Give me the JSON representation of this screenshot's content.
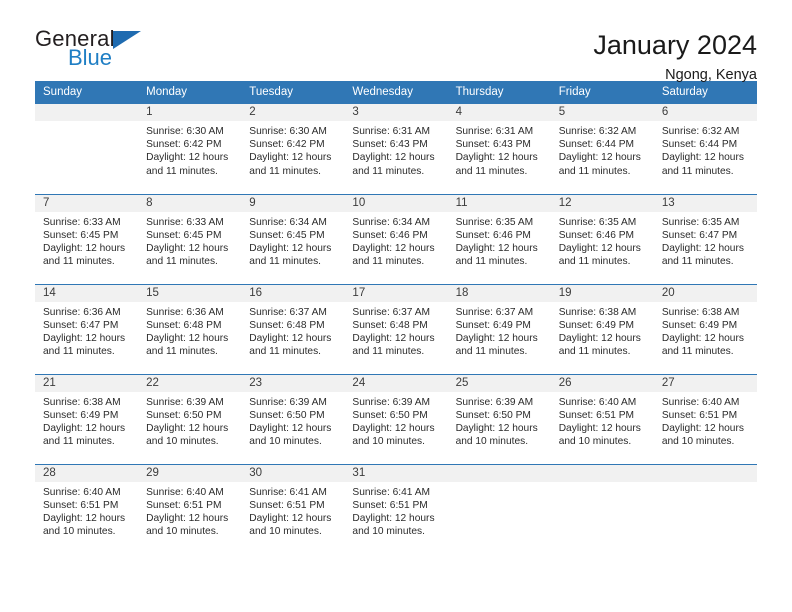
{
  "brand": {
    "name_part1": "General",
    "name_part2": "Blue",
    "triangle_color": "#1f6bb0",
    "blue_color": "#1f7ec4"
  },
  "header": {
    "title": "January 2024",
    "subtitle": "Ngong, Kenya"
  },
  "theme": {
    "header_blue": "#3077b5",
    "daynum_band": "#f1f1f1",
    "text": "#2b2b2b"
  },
  "weekdays": [
    "Sunday",
    "Monday",
    "Tuesday",
    "Wednesday",
    "Thursday",
    "Friday",
    "Saturday"
  ],
  "labels": {
    "sunrise_prefix": "Sunrise:",
    "sunset_prefix": "Sunset:",
    "daylight_prefix": "Daylight:"
  },
  "weeks": [
    [
      {
        "day": "",
        "sunrise": "",
        "sunset": "",
        "daylight": "",
        "empty": true
      },
      {
        "day": "1",
        "sunrise": "Sunrise: 6:30 AM",
        "sunset": "Sunset: 6:42 PM",
        "daylight": "Daylight: 12 hours and 11 minutes."
      },
      {
        "day": "2",
        "sunrise": "Sunrise: 6:30 AM",
        "sunset": "Sunset: 6:42 PM",
        "daylight": "Daylight: 12 hours and 11 minutes."
      },
      {
        "day": "3",
        "sunrise": "Sunrise: 6:31 AM",
        "sunset": "Sunset: 6:43 PM",
        "daylight": "Daylight: 12 hours and 11 minutes."
      },
      {
        "day": "4",
        "sunrise": "Sunrise: 6:31 AM",
        "sunset": "Sunset: 6:43 PM",
        "daylight": "Daylight: 12 hours and 11 minutes."
      },
      {
        "day": "5",
        "sunrise": "Sunrise: 6:32 AM",
        "sunset": "Sunset: 6:44 PM",
        "daylight": "Daylight: 12 hours and 11 minutes."
      },
      {
        "day": "6",
        "sunrise": "Sunrise: 6:32 AM",
        "sunset": "Sunset: 6:44 PM",
        "daylight": "Daylight: 12 hours and 11 minutes."
      }
    ],
    [
      {
        "day": "7",
        "sunrise": "Sunrise: 6:33 AM",
        "sunset": "Sunset: 6:45 PM",
        "daylight": "Daylight: 12 hours and 11 minutes."
      },
      {
        "day": "8",
        "sunrise": "Sunrise: 6:33 AM",
        "sunset": "Sunset: 6:45 PM",
        "daylight": "Daylight: 12 hours and 11 minutes."
      },
      {
        "day": "9",
        "sunrise": "Sunrise: 6:34 AM",
        "sunset": "Sunset: 6:45 PM",
        "daylight": "Daylight: 12 hours and 11 minutes."
      },
      {
        "day": "10",
        "sunrise": "Sunrise: 6:34 AM",
        "sunset": "Sunset: 6:46 PM",
        "daylight": "Daylight: 12 hours and 11 minutes."
      },
      {
        "day": "11",
        "sunrise": "Sunrise: 6:35 AM",
        "sunset": "Sunset: 6:46 PM",
        "daylight": "Daylight: 12 hours and 11 minutes."
      },
      {
        "day": "12",
        "sunrise": "Sunrise: 6:35 AM",
        "sunset": "Sunset: 6:46 PM",
        "daylight": "Daylight: 12 hours and 11 minutes."
      },
      {
        "day": "13",
        "sunrise": "Sunrise: 6:35 AM",
        "sunset": "Sunset: 6:47 PM",
        "daylight": "Daylight: 12 hours and 11 minutes."
      }
    ],
    [
      {
        "day": "14",
        "sunrise": "Sunrise: 6:36 AM",
        "sunset": "Sunset: 6:47 PM",
        "daylight": "Daylight: 12 hours and 11 minutes."
      },
      {
        "day": "15",
        "sunrise": "Sunrise: 6:36 AM",
        "sunset": "Sunset: 6:48 PM",
        "daylight": "Daylight: 12 hours and 11 minutes."
      },
      {
        "day": "16",
        "sunrise": "Sunrise: 6:37 AM",
        "sunset": "Sunset: 6:48 PM",
        "daylight": "Daylight: 12 hours and 11 minutes."
      },
      {
        "day": "17",
        "sunrise": "Sunrise: 6:37 AM",
        "sunset": "Sunset: 6:48 PM",
        "daylight": "Daylight: 12 hours and 11 minutes."
      },
      {
        "day": "18",
        "sunrise": "Sunrise: 6:37 AM",
        "sunset": "Sunset: 6:49 PM",
        "daylight": "Daylight: 12 hours and 11 minutes."
      },
      {
        "day": "19",
        "sunrise": "Sunrise: 6:38 AM",
        "sunset": "Sunset: 6:49 PM",
        "daylight": "Daylight: 12 hours and 11 minutes."
      },
      {
        "day": "20",
        "sunrise": "Sunrise: 6:38 AM",
        "sunset": "Sunset: 6:49 PM",
        "daylight": "Daylight: 12 hours and 11 minutes."
      }
    ],
    [
      {
        "day": "21",
        "sunrise": "Sunrise: 6:38 AM",
        "sunset": "Sunset: 6:49 PM",
        "daylight": "Daylight: 12 hours and 11 minutes."
      },
      {
        "day": "22",
        "sunrise": "Sunrise: 6:39 AM",
        "sunset": "Sunset: 6:50 PM",
        "daylight": "Daylight: 12 hours and 10 minutes."
      },
      {
        "day": "23",
        "sunrise": "Sunrise: 6:39 AM",
        "sunset": "Sunset: 6:50 PM",
        "daylight": "Daylight: 12 hours and 10 minutes."
      },
      {
        "day": "24",
        "sunrise": "Sunrise: 6:39 AM",
        "sunset": "Sunset: 6:50 PM",
        "daylight": "Daylight: 12 hours and 10 minutes."
      },
      {
        "day": "25",
        "sunrise": "Sunrise: 6:39 AM",
        "sunset": "Sunset: 6:50 PM",
        "daylight": "Daylight: 12 hours and 10 minutes."
      },
      {
        "day": "26",
        "sunrise": "Sunrise: 6:40 AM",
        "sunset": "Sunset: 6:51 PM",
        "daylight": "Daylight: 12 hours and 10 minutes."
      },
      {
        "day": "27",
        "sunrise": "Sunrise: 6:40 AM",
        "sunset": "Sunset: 6:51 PM",
        "daylight": "Daylight: 12 hours and 10 minutes."
      }
    ],
    [
      {
        "day": "28",
        "sunrise": "Sunrise: 6:40 AM",
        "sunset": "Sunset: 6:51 PM",
        "daylight": "Daylight: 12 hours and 10 minutes."
      },
      {
        "day": "29",
        "sunrise": "Sunrise: 6:40 AM",
        "sunset": "Sunset: 6:51 PM",
        "daylight": "Daylight: 12 hours and 10 minutes."
      },
      {
        "day": "30",
        "sunrise": "Sunrise: 6:41 AM",
        "sunset": "Sunset: 6:51 PM",
        "daylight": "Daylight: 12 hours and 10 minutes."
      },
      {
        "day": "31",
        "sunrise": "Sunrise: 6:41 AM",
        "sunset": "Sunset: 6:51 PM",
        "daylight": "Daylight: 12 hours and 10 minutes."
      },
      {
        "day": "",
        "sunrise": "",
        "sunset": "",
        "daylight": "",
        "empty": true
      },
      {
        "day": "",
        "sunrise": "",
        "sunset": "",
        "daylight": "",
        "empty": true
      },
      {
        "day": "",
        "sunrise": "",
        "sunset": "",
        "daylight": "",
        "empty": true
      }
    ]
  ]
}
